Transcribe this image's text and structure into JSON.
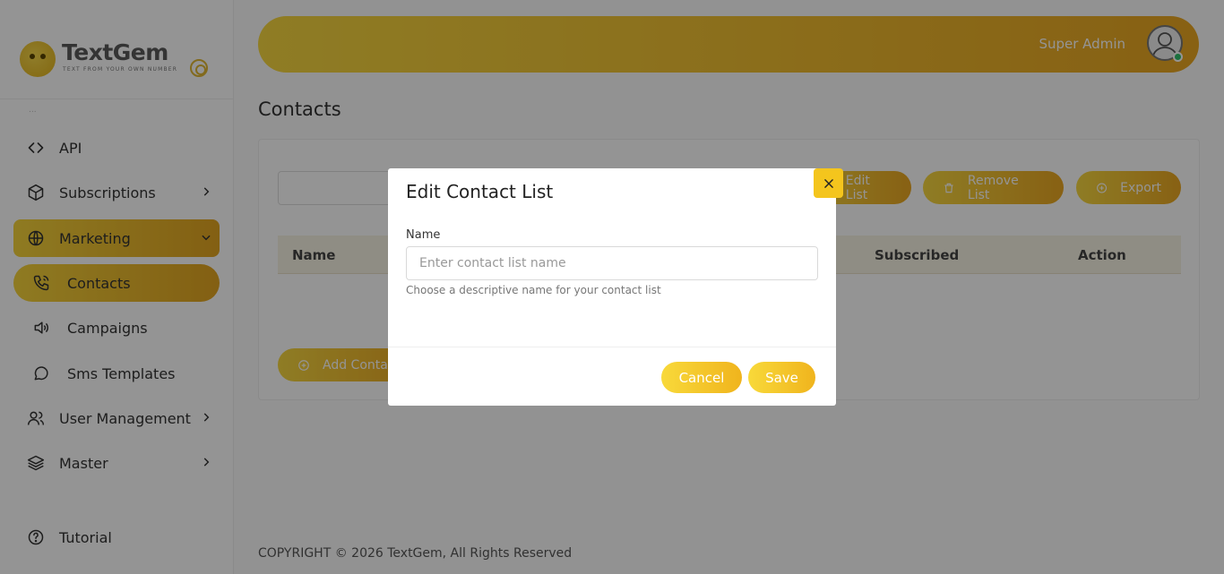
{
  "brand": {
    "name": "TextGem",
    "tagline": "TEXT FROM YOUR OWN NUMBER",
    "accent_color": "#f4c51d"
  },
  "sidebar": {
    "faint_label": "...",
    "items": [
      {
        "label": "API",
        "icon": "code-icon"
      },
      {
        "label": "Subscriptions",
        "icon": "box-icon"
      },
      {
        "label": "Marketing",
        "icon": "globe-icon"
      },
      {
        "label": "Contacts",
        "icon": "phone-icon"
      },
      {
        "label": "Campaigns",
        "icon": "speaker-icon"
      },
      {
        "label": "Sms Templates",
        "icon": "chat-icon"
      },
      {
        "label": "User Management",
        "icon": "users-icon"
      },
      {
        "label": "Master",
        "icon": "layers-icon"
      },
      {
        "label": "Tutorial",
        "icon": "help-icon"
      }
    ]
  },
  "header": {
    "user_name": "Super Admin"
  },
  "page": {
    "title": "Contacts"
  },
  "toolbar": {
    "edit_list": "Edit List",
    "remove_list": "Remove List",
    "export": "Export",
    "add_contact": "Add Contact"
  },
  "table": {
    "columns": [
      "Name",
      "Subscribed",
      "Action"
    ]
  },
  "footer": {
    "text": "COPYRIGHT © 2026 TextGem, All Rights Reserved"
  },
  "modal": {
    "title": "Edit Contact List",
    "field_label": "Name",
    "field_value": "",
    "field_placeholder": "Enter contact list name",
    "field_help": "Choose a descriptive name for your contact list",
    "cancel_label": "Cancel",
    "save_label": "Save"
  }
}
